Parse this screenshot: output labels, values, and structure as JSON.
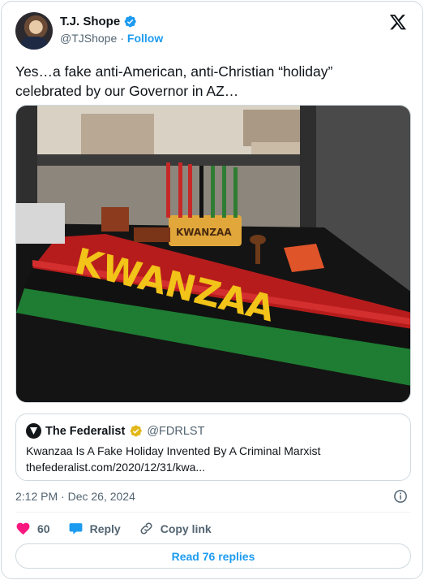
{
  "author": {
    "name": "T.J. Shope",
    "handle": "@TJShope",
    "separator": "·",
    "follow_label": "Follow"
  },
  "tweet": {
    "text": "Yes…a fake anti-American, anti-Christian “holiday”\ncelebrated by our Governor in AZ…",
    "photo_text": "KWANZAA",
    "photo_kinara_text": "KWANZAA"
  },
  "quoted": {
    "name": "The Federalist",
    "handle": "@FDRLST",
    "title": "Kwanzaa Is A Fake Holiday Invented By A Criminal Marxist",
    "link": "thefederalist.com/2020/12/31/kwa..."
  },
  "meta": {
    "timestamp": "2:12 PM · Dec 26, 2024"
  },
  "actions": {
    "likes": "60",
    "reply_label": "Reply",
    "copy_label": "Copy link"
  },
  "read_replies_label": "Read 76 replies",
  "colors": {
    "accent": "#1d9bf0",
    "like": "#f91880",
    "verified_blue": "#1d9bf0",
    "verified_gold": "#e2b719"
  }
}
